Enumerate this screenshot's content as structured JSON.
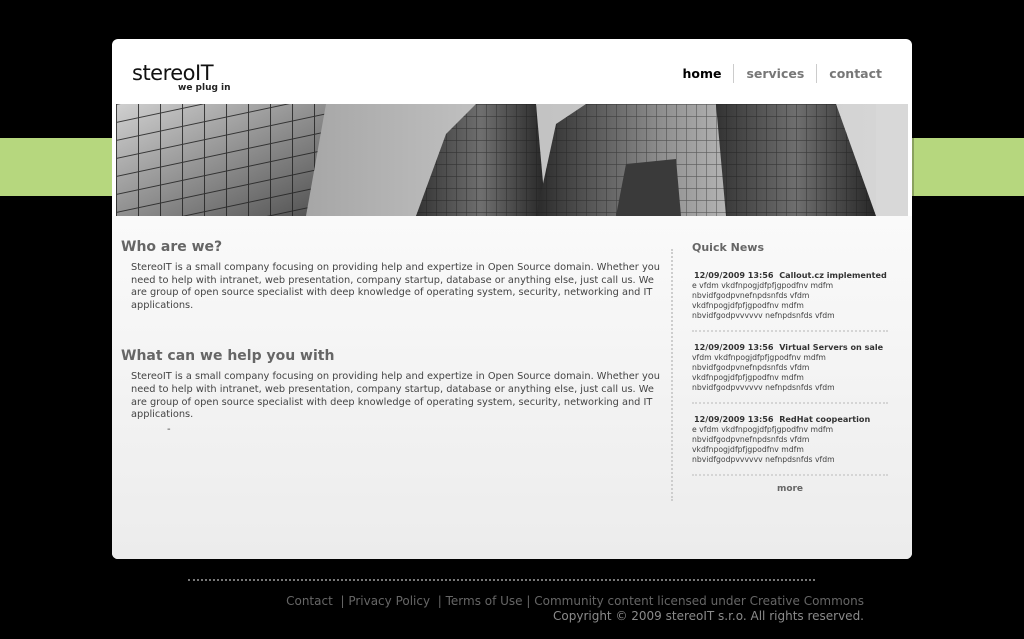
{
  "brand": {
    "name": "stereoIT",
    "tagline": "we plug in"
  },
  "nav": {
    "items": [
      {
        "label": "home",
        "active": true
      },
      {
        "label": "services",
        "active": false
      },
      {
        "label": "contact",
        "active": false
      }
    ]
  },
  "colors": {
    "background": "#000000",
    "accent_band": "#b6d77e",
    "card": "#ffffff"
  },
  "main": {
    "sections": [
      {
        "heading": "Who are we?",
        "text": "StereoIT is a small company focusing on providing help and expertize in Open Source domain. Whether you need to help with intranet, web presentation, company startup, database or anything else, just call us. We are group of open source specialist with deep knowledge of operating system, security, networking and IT applications."
      },
      {
        "heading": "What can we help you with",
        "text": "StereoIT is a small company focusing on providing help and expertize in Open Source domain. Whether you need to help with intranet, web presentation, company startup, database or anything else, just call us. We are group of open source specialist with deep knowledge of operating system, security, networking and IT applications.",
        "trailing": "-"
      }
    ]
  },
  "news": {
    "title": "Quick News",
    "items": [
      {
        "date": "12/09/2009 13:56",
        "headline": "Callout.cz implemented",
        "lines": [
          "e vfdm vkdfnpogjdfpfjgpodfnv mdfm",
          "nbvidfgodpvnefnpdsnfds vfdm",
          "vkdfnpogjdfpfjgpodfnv mdfm",
          "nbvidfgodpvvvvvv nefnpdsnfds vfdm"
        ]
      },
      {
        "date": "12/09/2009 13:56",
        "headline": "Virtual Servers on sale",
        "lines": [
          "vfdm vkdfnpogjdfpfjgpodfnv mdfm",
          "nbvidfgodpvnefnpdsnfds vfdm",
          "vkdfnpogjdfpfjgpodfnv mdfm",
          "nbvidfgodpvvvvvv nefnpdsnfds vfdm"
        ]
      },
      {
        "date": "12/09/2009 13:56",
        "headline": "RedHat coopeartion",
        "lines": [
          "e vfdm vkdfnpogjdfpfjgpodfnv mdfm",
          "nbvidfgodpvnefnpdsnfds vfdm",
          "vkdfnpogjdfpfjgpodfnv mdfm",
          "nbvidfgodpvvvvvv nefnpdsnfds vfdm"
        ]
      }
    ],
    "more": "more"
  },
  "footer": {
    "links": [
      "Contact",
      "Privacy Policy",
      "Terms of Use",
      "Community content licensed under Creative Commons"
    ],
    "copyright": "Copyright © 2009 stereoIT s.r.o. All rights reserved."
  }
}
